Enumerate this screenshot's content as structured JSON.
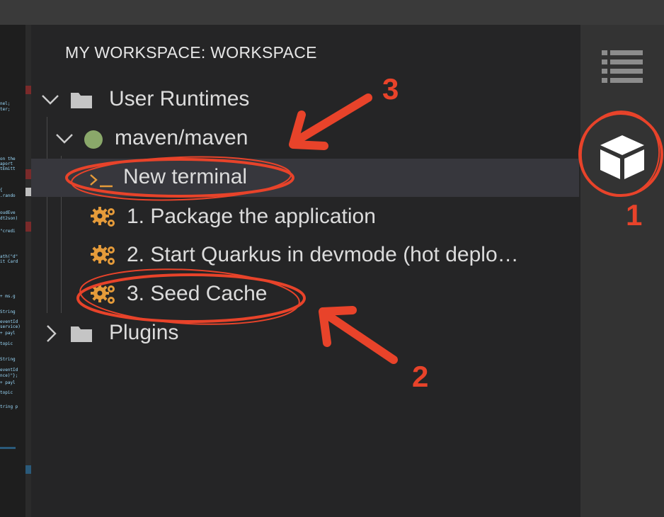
{
  "panel": {
    "title": "MY WORKSPACE: WORKSPACE",
    "tree": {
      "user_runtimes": "User Runtimes",
      "runtime": "maven/maven",
      "new_terminal": "New terminal",
      "command_1": "1. Package the application",
      "command_2": "2. Start Quarkus in devmode (hot deplo…",
      "command_3": "3. Seed Cache",
      "plugins": "Plugins"
    }
  },
  "activity_bar": {
    "items": [
      {
        "icon": "list-icon"
      },
      {
        "icon": "cube-icon",
        "active": true
      }
    ]
  },
  "annotations": {
    "numbers": [
      "1",
      "2",
      "3"
    ],
    "color": "#e8432a"
  },
  "colors": {
    "running_dot": "#8aa86a",
    "gear": "#e59b3a",
    "terminal_prompt": "#e59b3a"
  }
}
